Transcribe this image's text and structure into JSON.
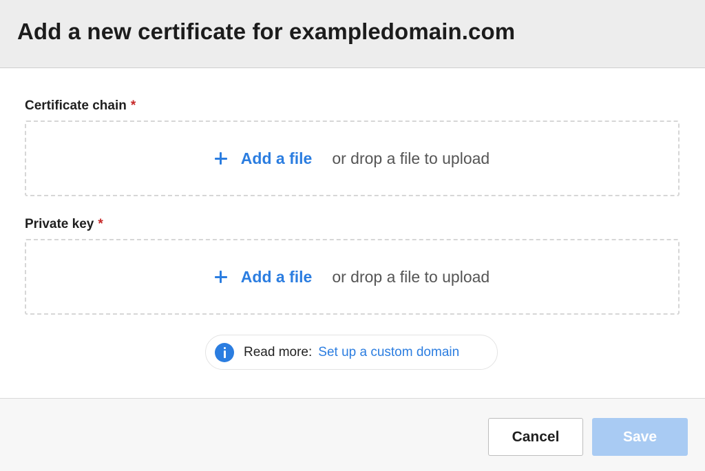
{
  "dialog": {
    "title": "Add a new certificate for exampledomain.com"
  },
  "fields": [
    {
      "label": "Certificate chain",
      "required_mark": "*",
      "add_link": "Add a file",
      "drop_text": "or drop a file to upload"
    },
    {
      "label": "Private key",
      "required_mark": "*",
      "add_link": "Add a file",
      "drop_text": "or drop a file to upload"
    }
  ],
  "info": {
    "label": "Read more:",
    "link": "Set up a custom domain",
    "icon": "info-icon"
  },
  "footer": {
    "cancel_label": "Cancel",
    "save_label": "Save",
    "save_enabled": false
  },
  "colors": {
    "accent": "#2b7de0",
    "required": "#c62828",
    "save_disabled": "#a9cbf3",
    "header_bg": "#ededed"
  }
}
